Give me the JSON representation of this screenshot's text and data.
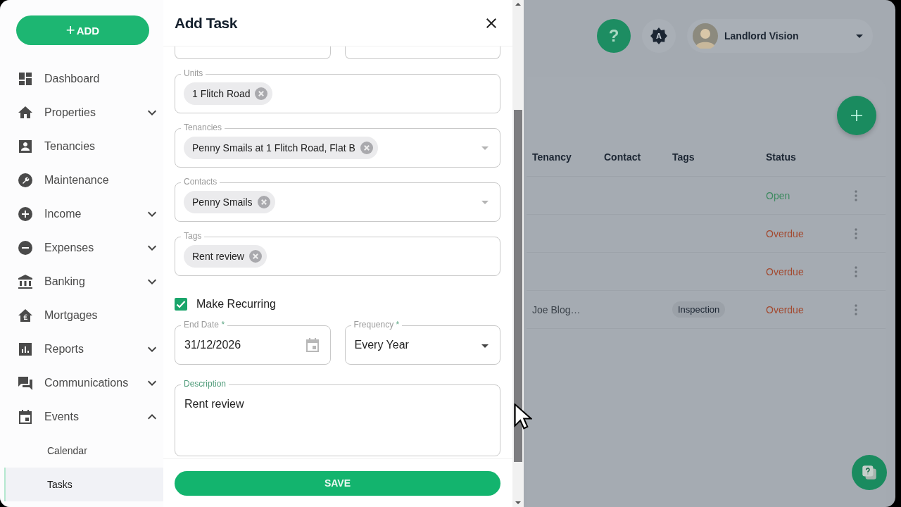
{
  "sidebar": {
    "add_button": {
      "icon": "+",
      "label": "ADD"
    },
    "items": [
      {
        "label": "Dashboard"
      },
      {
        "label": "Properties",
        "expanded": false
      },
      {
        "label": "Tenancies"
      },
      {
        "label": "Maintenance"
      },
      {
        "label": "Income",
        "expanded": false
      },
      {
        "label": "Expenses",
        "expanded": false
      },
      {
        "label": "Banking",
        "expanded": false
      },
      {
        "label": "Mortgages"
      },
      {
        "label": "Reports",
        "expanded": false
      },
      {
        "label": "Communications",
        "expanded": false
      },
      {
        "label": "Events",
        "expanded": true,
        "children": [
          {
            "label": "Calendar",
            "selected": false
          },
          {
            "label": "Tasks",
            "selected": true
          }
        ]
      }
    ]
  },
  "dialog": {
    "title": "Add Task",
    "cut_fields": [
      {
        "kind": "outlined"
      },
      {
        "kind": "outlined"
      }
    ],
    "chip_fields": [
      {
        "label": "Units",
        "chips": [
          "1 Flitch Road"
        ],
        "dropdown": false
      },
      {
        "label": "Tenancies",
        "chips": [
          "Penny Smails at 1 Flitch Road, Flat B"
        ],
        "dropdown": true
      },
      {
        "label": "Contacts",
        "chips": [
          "Penny Smails"
        ],
        "dropdown": true
      },
      {
        "label": "Tags",
        "chips": [
          "Rent review"
        ],
        "dropdown": false
      }
    ],
    "recurring": {
      "label": "Make Recurring",
      "checked": true
    },
    "end_date": {
      "label": "End Date",
      "asterisk": "*",
      "value": "31/12/2026"
    },
    "frequency": {
      "label": "Frequency",
      "asterisk": "*",
      "value": "Every Year"
    },
    "description": {
      "label": "Description",
      "value": "Rent review",
      "focused": true
    },
    "save_button": "SAVE"
  },
  "header": {
    "help_button": "?",
    "theme_badge": "A",
    "user_name": "Landlord Vision"
  },
  "table": {
    "columns": [
      "Tenancy",
      "Contact",
      "Tags",
      "Status"
    ],
    "rows": [
      {
        "status": "Open",
        "color": "#3e8a60"
      },
      {
        "status": "Overdue",
        "color": "#a34a30"
      },
      {
        "status": "Overdue",
        "color": "#a34a30"
      },
      {
        "tenancy": "Joe Blog…",
        "tag": "Inspection",
        "status": "Overdue",
        "color": "#a34a30"
      }
    ]
  }
}
